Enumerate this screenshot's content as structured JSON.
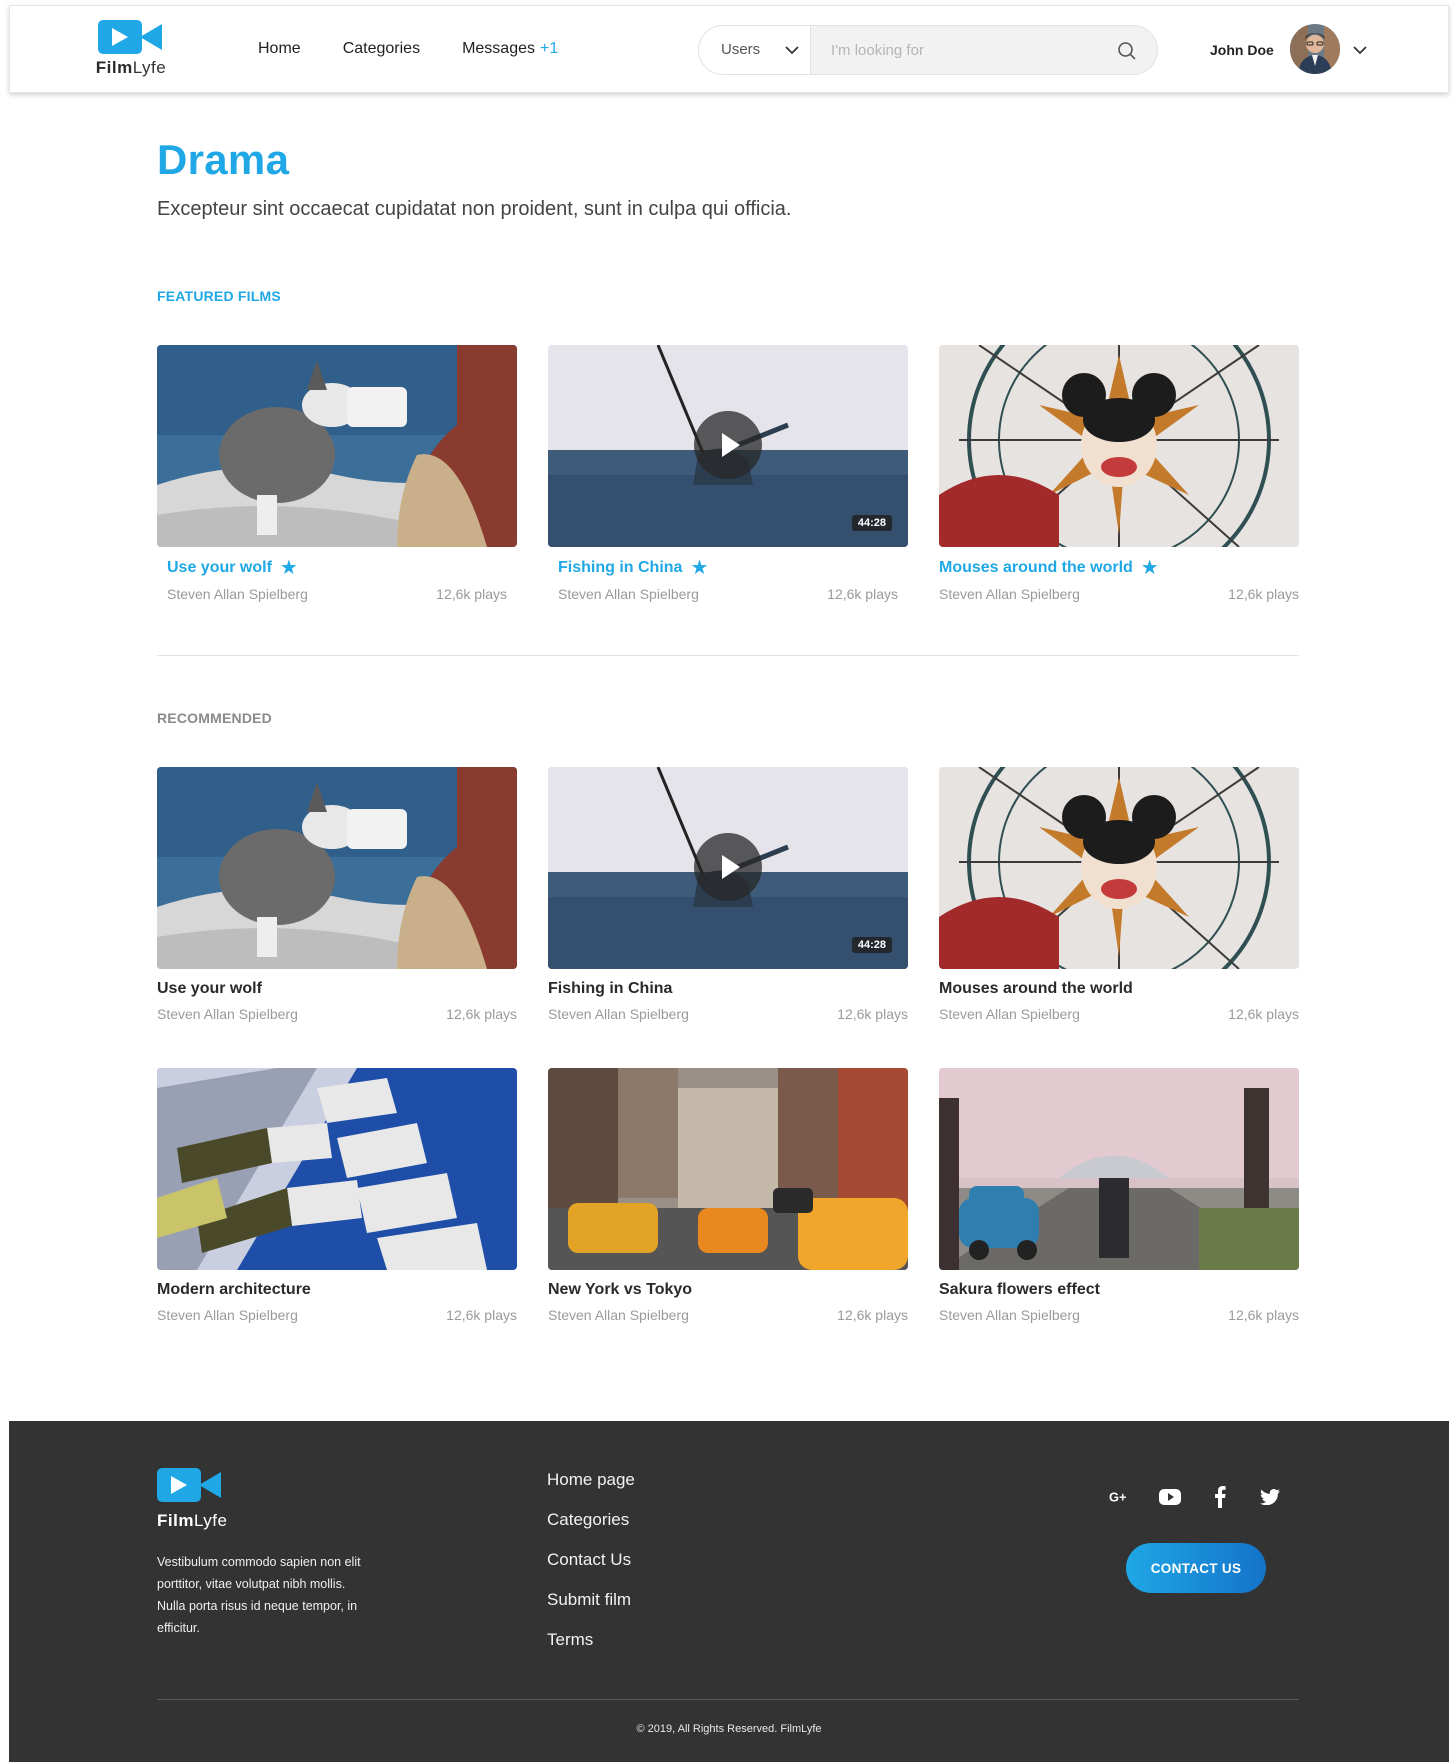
{
  "brand": {
    "name_bold": "Film",
    "name_light": "Lyfe",
    "accent": "#1fa7e6"
  },
  "nav": {
    "home": "Home",
    "categories": "Categories",
    "messages": "Messages",
    "messages_badge": "+1"
  },
  "search": {
    "scope": "Users",
    "placeholder": "I'm looking for"
  },
  "user": {
    "name": "John Doe"
  },
  "page": {
    "title": "Drama",
    "subtitle": "Excepteur sint occaecat cupidatat non proident, sunt in culpa qui officia."
  },
  "featured": {
    "label": "FEATURED FILMS",
    "items": [
      {
        "title": "Use your wolf",
        "author": "Steven Allan Spielberg",
        "plays": "12,6k plays"
      },
      {
        "title": "Fishing in China",
        "author": "Steven Allan Spielberg",
        "plays": "12,6k plays",
        "duration": "44:28"
      },
      {
        "title": "Mouses around the world",
        "author": "Steven Allan Spielberg",
        "plays": "12,6k plays"
      }
    ]
  },
  "recommended": {
    "label": "RECOMMENDED",
    "items": [
      {
        "title": "Use your wolf",
        "author": "Steven Allan Spielberg",
        "plays": "12,6k plays"
      },
      {
        "title": "Fishing in China",
        "author": "Steven Allan Spielberg",
        "plays": "12,6k plays",
        "duration": "44:28"
      },
      {
        "title": "Mouses around the world",
        "author": "Steven Allan Spielberg",
        "plays": "12,6k plays"
      },
      {
        "title": "Modern architecture",
        "author": "Steven Allan Spielberg",
        "plays": "12,6k plays"
      },
      {
        "title": "New York vs Tokyo",
        "author": "Steven Allan Spielberg",
        "plays": "12,6k plays"
      },
      {
        "title": "Sakura flowers effect",
        "author": "Steven Allan Spielberg",
        "plays": "12,6k plays"
      }
    ]
  },
  "footer": {
    "description": "Vestibulum commodo sapien non elit porttitor, vitae volutpat nibh mollis. Nulla porta risus id neque tempor, in efficitur.",
    "links": [
      "Home page",
      "Categories",
      "Contact Us",
      "Submit film",
      "Terms"
    ],
    "socials": [
      "google-plus-icon",
      "youtube-icon",
      "facebook-icon",
      "twitter-icon"
    ],
    "contact_label": "CONTACT US",
    "copyright": "© 2019, All Rights Reserved. FilmLyfe"
  }
}
